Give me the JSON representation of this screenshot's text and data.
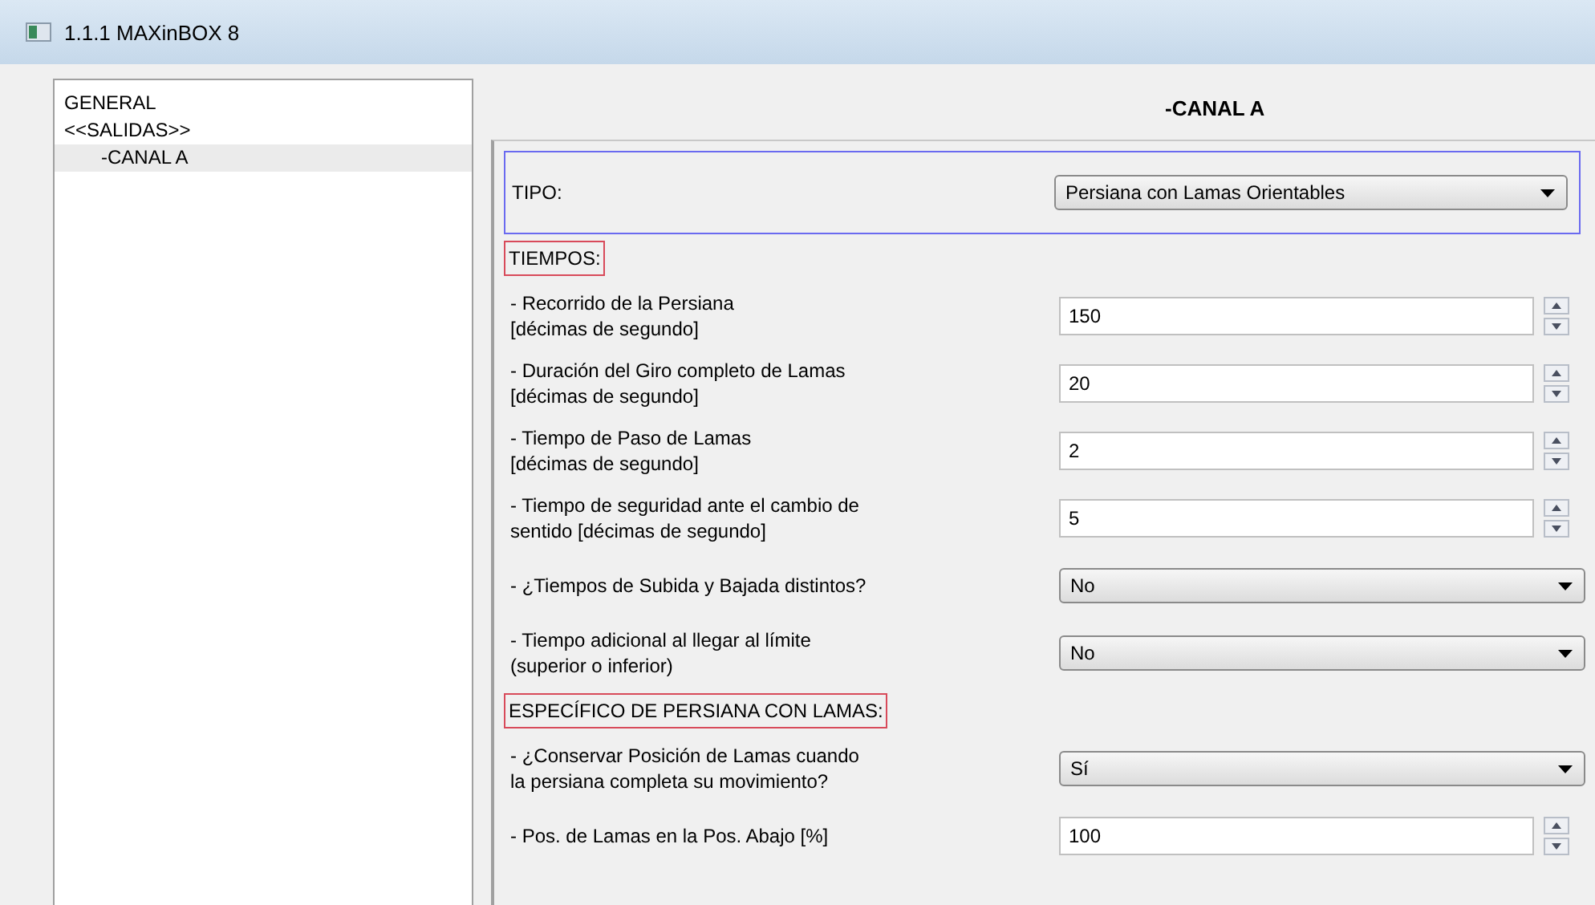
{
  "window": {
    "title": "1.1.1 MAXinBOX 8"
  },
  "tree": [
    {
      "label": "GENERAL",
      "selected": false
    },
    {
      "label": "<<SALIDAS>>",
      "selected": false,
      "children": [
        {
          "label": "-CANAL A",
          "selected": true
        }
      ]
    }
  ],
  "panel": {
    "title": "-CANAL A",
    "type_row": {
      "label": "TIPO:",
      "value": "Persiana con Lamas Orientables"
    },
    "sections": [
      {
        "title": "TIEMPOS:",
        "rows": [
          {
            "kind": "spin",
            "label": "- Recorrido de la Persiana\n  [décimas de segundo]",
            "value": "150"
          },
          {
            "kind": "spin",
            "label": "- Duración del Giro completo de Lamas\n  [décimas de segundo]",
            "value": "20"
          },
          {
            "kind": "spin",
            "label": "- Tiempo de Paso de Lamas\n  [décimas de segundo]",
            "value": "2"
          },
          {
            "kind": "spin",
            "label": "- Tiempo de seguridad ante el cambio de\n  sentido [décimas de segundo]",
            "value": "5"
          },
          {
            "kind": "select",
            "label": "- ¿Tiempos de Subida y Bajada distintos?",
            "value": "No"
          },
          {
            "kind": "select",
            "label": "- Tiempo adicional al llegar al límite\n  (superior o inferior)",
            "value": "No"
          }
        ]
      },
      {
        "title": "ESPECÍFICO DE PERSIANA CON LAMAS:",
        "rows": [
          {
            "kind": "select",
            "label": "- ¿Conservar Posición de Lamas cuando\n  la persiana completa su movimiento?",
            "value": "Sí"
          },
          {
            "kind": "spin",
            "label": "- Pos. de Lamas en la Pos. Abajo [%]",
            "value": "100"
          }
        ]
      }
    ]
  }
}
